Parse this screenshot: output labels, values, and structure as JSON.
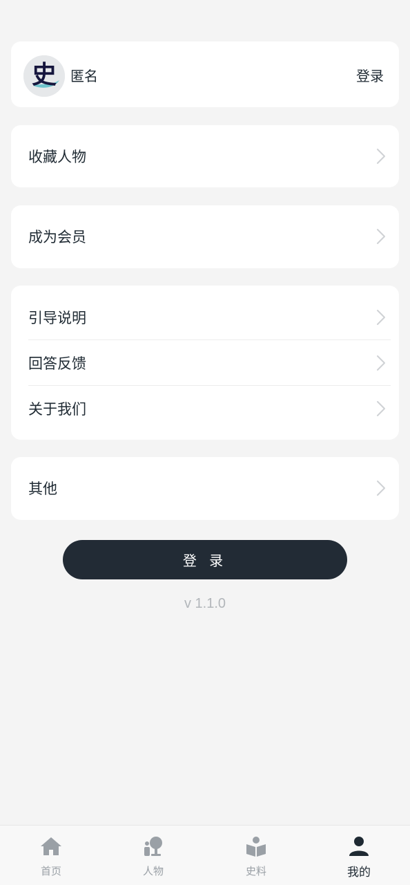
{
  "profile": {
    "avatar_glyph": "史",
    "name": "匿名",
    "login_link": "登录"
  },
  "menu": {
    "favorites": "收藏人物",
    "membership": "成为会员",
    "guide": "引导说明",
    "feedback": "回答反馈",
    "about": "关于我们",
    "other": "其他"
  },
  "login_button": "登 录",
  "version": "v 1.1.0",
  "tabs": [
    {
      "label": "首页",
      "icon": "home-icon",
      "active": false
    },
    {
      "label": "人物",
      "icon": "person-bust-icon",
      "active": false
    },
    {
      "label": "史料",
      "icon": "open-book-icon",
      "active": false
    },
    {
      "label": "我的",
      "icon": "user-icon",
      "active": true
    }
  ],
  "colors": {
    "background": "#f4f4f4",
    "card": "#ffffff",
    "primary_dark": "#222b35",
    "inactive_tab": "#9aa0a6",
    "accent_teal": "#6fc4cc"
  }
}
